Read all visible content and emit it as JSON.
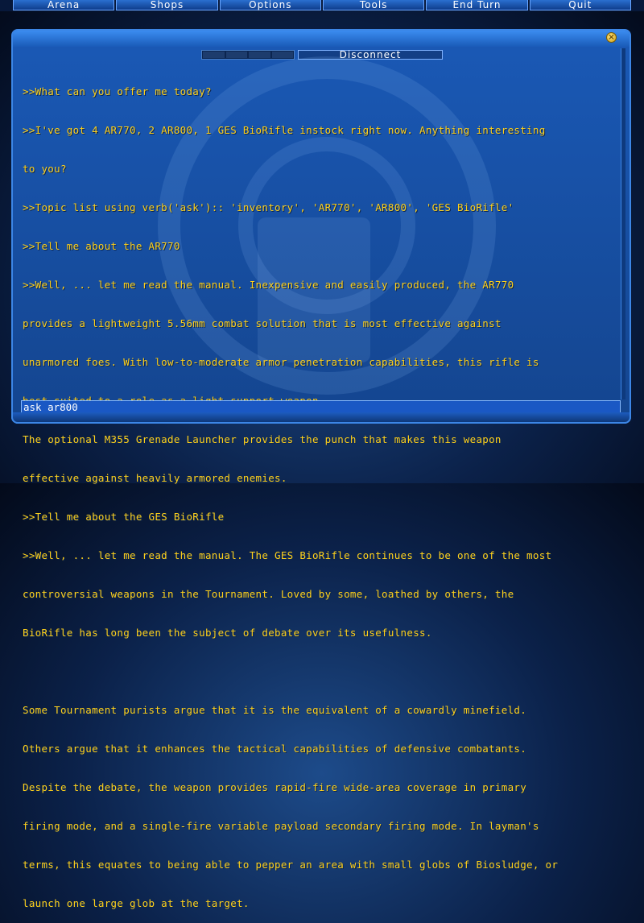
{
  "menu": {
    "items": [
      "Arena",
      "Shops",
      "Options",
      "Tools",
      "End Turn",
      "Quit"
    ]
  },
  "tabs": {
    "disconnect_label": "Disconnect"
  },
  "chat": {
    "lines": [
      ">>What can you offer me today?",
      ">>I've got 4 AR770, 2 AR800, 1 GES BioRifle instock right now. Anything interesting",
      "to you?",
      ">>Topic list using verb('ask'):: 'inventory', 'AR770', 'AR800', 'GES BioRifle'",
      ">>Tell me about the AR770",
      ">>Well, ... let me read the manual. Inexpensive and easily produced, the AR770",
      "provides a lightweight 5.56mm combat solution that is most effective against",
      "unarmored foes. With low-to-moderate armor penetration capabilities, this rifle is",
      "best suited to a role as a light support weapon.",
      "The optional M355 Grenade Launcher provides the punch that makes this weapon",
      "effective against heavily armored enemies.",
      ">>Tell me about the GES BioRifle",
      ">>Well, ... let me read the manual. The GES BioRifle continues to be one of the most",
      "controversial weapons in the Tournament. Loved by some, loathed by others, the",
      "BioRifle has long been the subject of debate over its usefulness.",
      "",
      "Some Tournament purists argue that it is the equivalent of a cowardly minefield.",
      "Others argue that it enhances the tactical capabilities of defensive combatants.",
      "Despite the debate, the weapon provides rapid-fire wide-area coverage in primary",
      "firing mode, and a single-fire variable payload secondary firing mode. In layman's",
      "terms, this equates to being able to pepper an area with small globs of Biosludge, or",
      "launch one large glob at the target."
    ]
  },
  "input": {
    "value": "ask ar800"
  },
  "colors": {
    "chat_text": "#ffd11a",
    "accent": "#3c86e6",
    "close_button": "#e0b020"
  }
}
